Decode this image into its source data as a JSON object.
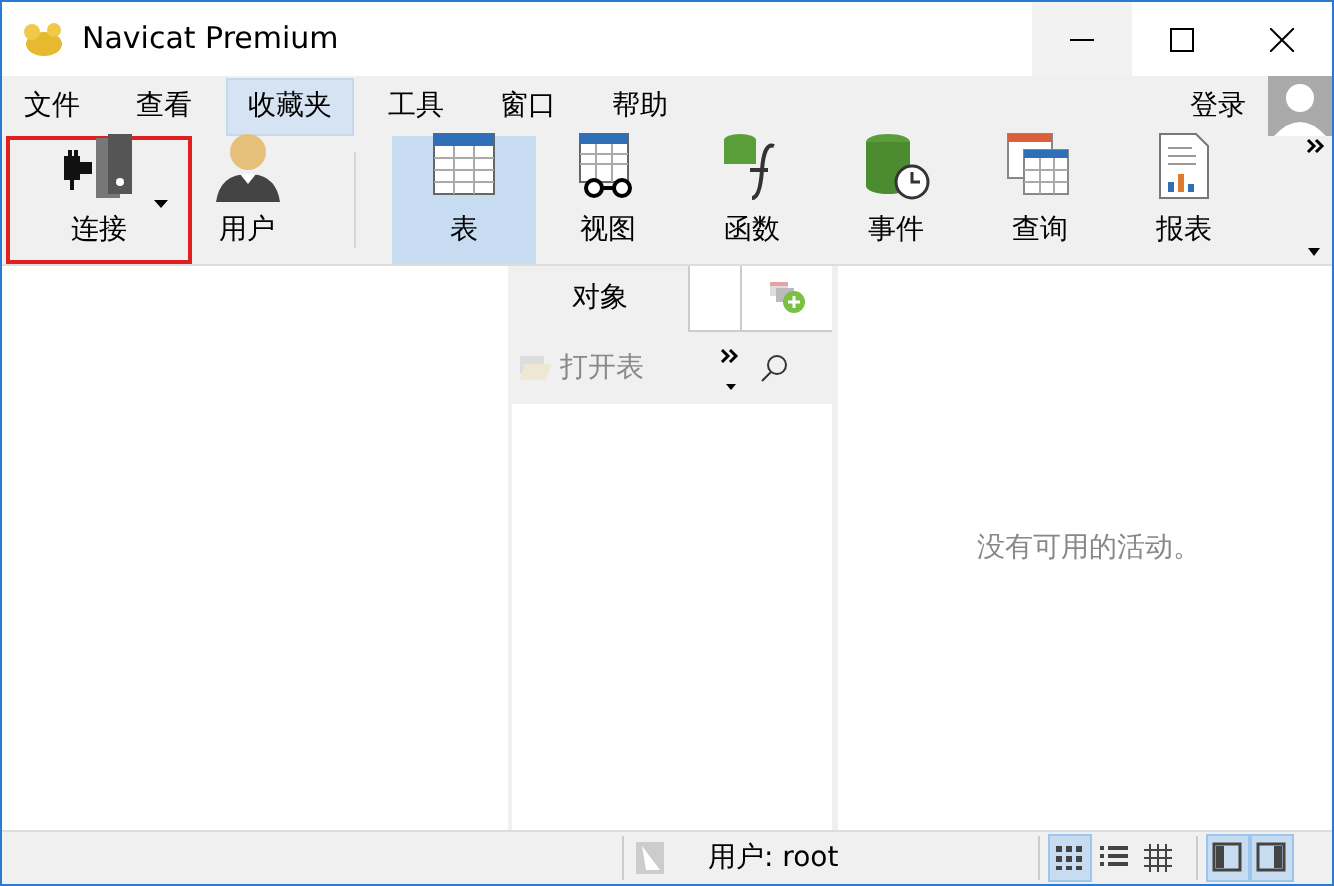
{
  "window": {
    "title": "Navicat Premium"
  },
  "menu": [
    {
      "label": "文件",
      "selected": false
    },
    {
      "label": "查看",
      "selected": false
    },
    {
      "label": "收藏夹",
      "selected": true
    },
    {
      "label": "工具",
      "selected": false
    },
    {
      "label": "窗口",
      "selected": false
    },
    {
      "label": "帮助",
      "selected": false
    }
  ],
  "login": "登录",
  "toolbar": [
    {
      "kind": "connection",
      "label": "连接",
      "selected": false,
      "outlined": true,
      "dropdown": true
    },
    {
      "kind": "user",
      "label": "用户",
      "selected": false,
      "outlined": false,
      "dropdown": false
    },
    {
      "kind": "table",
      "label": "表",
      "selected": true,
      "outlined": false,
      "dropdown": false
    },
    {
      "kind": "view",
      "label": "视图",
      "selected": false,
      "outlined": false,
      "dropdown": false
    },
    {
      "kind": "function",
      "label": "函数",
      "selected": false,
      "outlined": false,
      "dropdown": false
    },
    {
      "kind": "event",
      "label": "事件",
      "selected": false,
      "outlined": false,
      "dropdown": false
    },
    {
      "kind": "query",
      "label": "查询",
      "selected": false,
      "outlined": false,
      "dropdown": false
    },
    {
      "kind": "report",
      "label": "报表",
      "selected": false,
      "outlined": false,
      "dropdown": false
    }
  ],
  "object_tabs": [
    {
      "kind": "text",
      "label": "对象",
      "selected": true
    },
    {
      "kind": "blank",
      "selected": false
    },
    {
      "kind": "add",
      "selected": false
    }
  ],
  "object_toolbar": {
    "open_table": {
      "label": "打开表",
      "disabled": true
    }
  },
  "activity": {
    "message": "没有可用的活动。"
  },
  "status_bar": {
    "user": "用户: root",
    "views": [
      {
        "kind": "grid",
        "selected": true
      },
      {
        "kind": "list",
        "selected": false
      },
      {
        "kind": "detail",
        "selected": false
      }
    ],
    "panes": [
      {
        "kind": "left",
        "selected": true
      },
      {
        "kind": "right",
        "selected": true
      }
    ]
  }
}
